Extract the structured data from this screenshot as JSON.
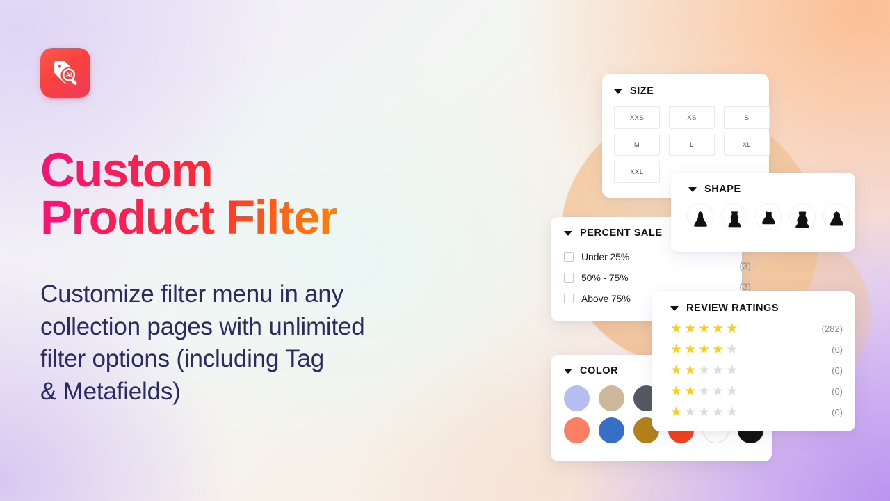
{
  "brand": {
    "logo_icon": "ai-tag-search-icon",
    "logo_text": "AI"
  },
  "hero": {
    "headline": "Custom\nProduct Filter",
    "subheadline": "Customize filter menu in any\ncollection pages with unlimited\nfilter options (including Tag\n& Metafields)",
    "headline_gradient_from": "#f4137b",
    "headline_gradient_to": "#fd8008",
    "subheadline_color": "#2b2a63"
  },
  "cards": {
    "size": {
      "title": "SIZE",
      "caret_icon": "caret-down-icon",
      "options": [
        "XXS",
        "XS",
        "S",
        "M",
        "L",
        "XL",
        "XXL"
      ]
    },
    "shape": {
      "title": "SHAPE",
      "caret_icon": "caret-down-icon",
      "options": [
        "dress-a-line-icon",
        "dress-fit-flare-icon",
        "dress-skater-icon",
        "dress-bodycon-icon",
        "dress-ballgown-icon"
      ]
    },
    "percent_sale": {
      "title": "PERCENT SALE",
      "caret_icon": "caret-down-icon",
      "rows": [
        {
          "label": "Under 25%",
          "count": "",
          "checked": false
        },
        {
          "label": "50% - 75%",
          "count": "",
          "checked": false
        },
        {
          "label": "Above 75%",
          "count": "",
          "checked": false
        }
      ]
    },
    "floating_counts": [
      "(3)",
      "(3)"
    ],
    "review_ratings": {
      "title": "REVIEW RATINGS",
      "caret_icon": "caret-down-icon",
      "star_color": "#f8cf1c",
      "star_empty_color": "#dcdcdc",
      "rows": [
        {
          "stars": 5,
          "count": "(282)"
        },
        {
          "stars": 4,
          "count": "(6)"
        },
        {
          "stars": 2,
          "count": "(0)"
        },
        {
          "stars": 2,
          "count": "(0)"
        },
        {
          "stars": 1,
          "count": "(0)"
        }
      ]
    },
    "color": {
      "title": "COLOR",
      "caret_icon": "caret-down-icon",
      "swatches": [
        {
          "name": "periwinkle",
          "hex": "#b6bdf0"
        },
        {
          "name": "tan",
          "hex": "#cdb79a"
        },
        {
          "name": "charcoal",
          "hex": "#565963"
        },
        {
          "name": "empty-1",
          "hex": ""
        },
        {
          "name": "empty-2",
          "hex": ""
        },
        {
          "name": "empty-3",
          "hex": ""
        },
        {
          "name": "salmon",
          "hex": "#fb7f65"
        },
        {
          "name": "blue",
          "hex": "#3570c6"
        },
        {
          "name": "dark-gold",
          "hex": "#b4821a"
        },
        {
          "name": "orange-red",
          "hex": "#f4441b"
        },
        {
          "name": "white",
          "hex": "#ffffff"
        },
        {
          "name": "black",
          "hex": "#101010"
        }
      ]
    }
  }
}
